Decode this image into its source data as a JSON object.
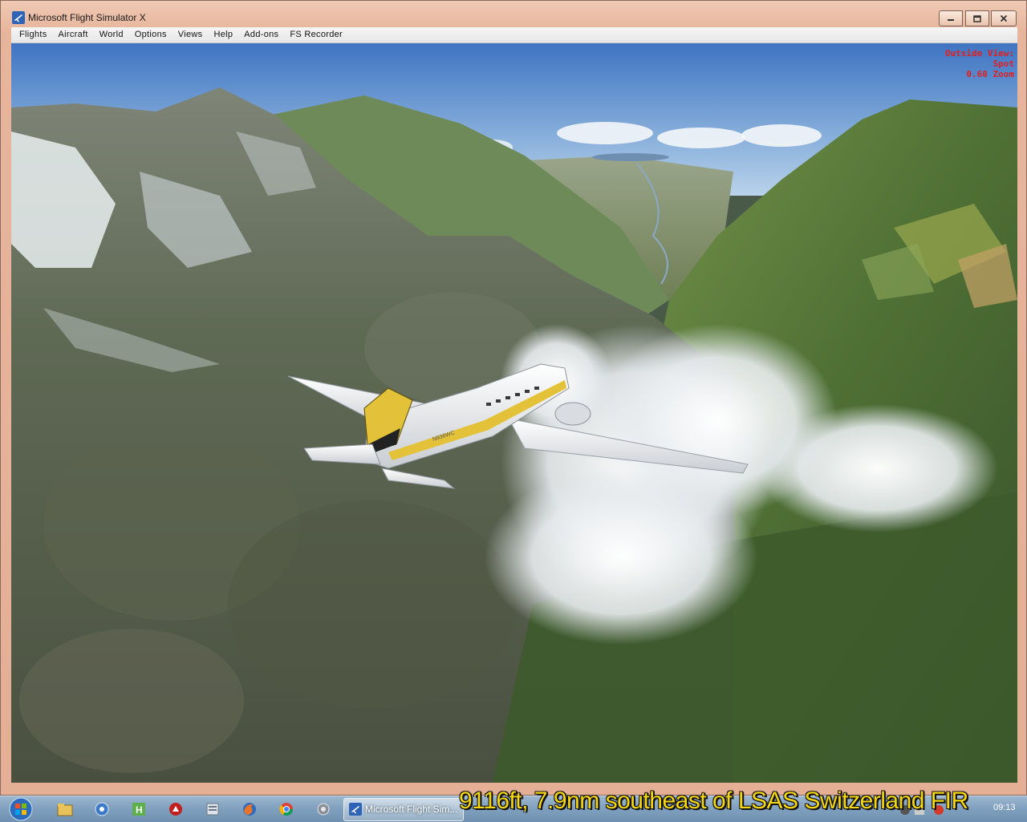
{
  "window": {
    "title": "Microsoft Flight Simulator X",
    "controls": {
      "minimize": "minimize",
      "maximize": "maximize",
      "close": "close"
    }
  },
  "menu": {
    "items": [
      "Flights",
      "Aircraft",
      "World",
      "Options",
      "Views",
      "Help",
      "Add-ons",
      "FS Recorder"
    ]
  },
  "view_info": {
    "line1": "Outside View:",
    "line2": "Spot",
    "line3": "0.60 Zoom"
  },
  "aircraft": {
    "registration": "N936WC"
  },
  "taskbar": {
    "active_task_label": "Microsoft Flight Sim...",
    "clock": "09:13",
    "pinned_icons": [
      "windows-explorer-icon",
      "network-icon",
      "spreadsheet-icon",
      "media-icon",
      "folder-icon",
      "firefox-icon",
      "chrome-icon",
      "settings-icon"
    ]
  },
  "caption": "9116ft, 7.9nm southeast of LSAS Switzerland FIR",
  "colors": {
    "caption": "#f5d615",
    "view_info": "#e02020",
    "frame": "#e7b59c"
  }
}
